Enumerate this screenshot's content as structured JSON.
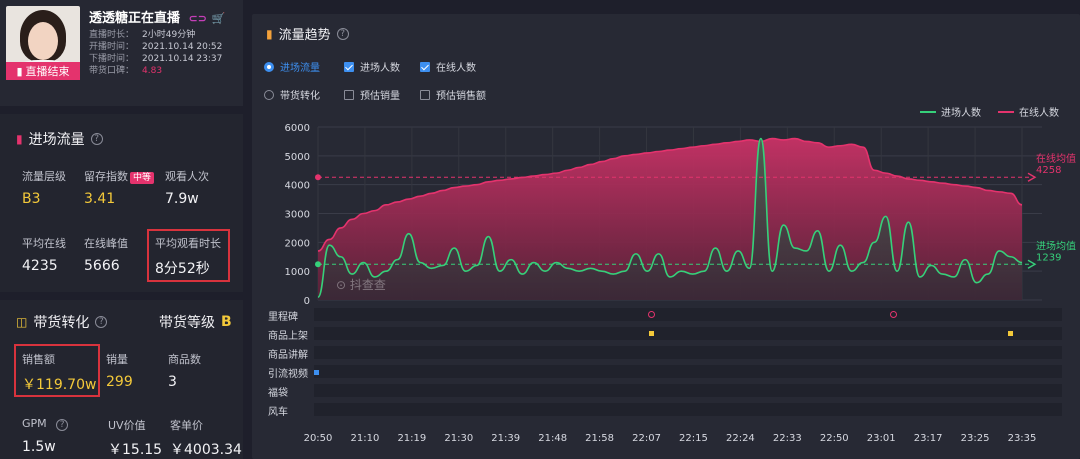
{
  "streamer": {
    "name": "透透糖正在直播",
    "live_status": "直播结束",
    "live_duration_label": "直播时长：",
    "live_duration": "2小时49分钟",
    "start_label": "开播时间：",
    "start_time": "2021.10.14 20:52",
    "end_label": "下播时间：",
    "end_time": "2021.10.14 23:37",
    "reputation_label": "带货口碑：",
    "reputation": "4.83"
  },
  "traffic": {
    "title": "进场流量",
    "flow_level_label": "流量层级",
    "flow_level": "B3",
    "retention_label": "留存指数",
    "retention_tag": "中等",
    "retention": "3.41",
    "views_label": "观看人次",
    "views": "7.9w",
    "avg_online_label": "平均在线",
    "avg_online": "4235",
    "peak_label": "在线峰值",
    "peak": "5666",
    "avg_watch_label": "平均观看时长",
    "avg_watch": "8分52秒"
  },
  "conversion": {
    "title": "带货转化",
    "grade_label": "带货等级",
    "grade": "B",
    "sales_label": "销售额",
    "sales": "￥119.70w",
    "volume_label": "销量",
    "volume": "299",
    "products_label": "商品数",
    "products": "3",
    "gpm_label": "GPM",
    "gpm": "1.5w",
    "uv_label": "UV价值",
    "uv": "￥15.15",
    "price_label": "客单价",
    "price": "￥4003.34"
  },
  "trend": {
    "title": "流量趋势",
    "radio_traffic": "进场流量",
    "radio_conversion": "带货转化",
    "cb_enter": "进场人数",
    "cb_online": "在线人数",
    "cb_est_volume": "预估销量",
    "cb_est_sales": "预估销售额",
    "online_avg_label": "在线均值",
    "online_avg": "4258",
    "enter_avg_label": "进场均值",
    "enter_avg": "1239",
    "watermark": "抖查查",
    "tracks": [
      "里程碑",
      "商品上架",
      "商品讲解",
      "引流视频",
      "福袋",
      "风车"
    ]
  },
  "colors": {
    "online": "#e4336d",
    "enter": "#36d07a",
    "accent_blue": "#3d8ff0",
    "highlight_red": "#d8333d",
    "yellow": "#f3c93a"
  },
  "chart_data": {
    "type": "area",
    "title": "",
    "ylim": [
      0,
      6000
    ],
    "y_ticks": [
      "0",
      "1000",
      "2000",
      "3000",
      "4000",
      "5000",
      "6000"
    ],
    "x_ticks": [
      "20:50",
      "21:10",
      "21:19",
      "21:30",
      "21:39",
      "21:48",
      "21:58",
      "22:07",
      "22:15",
      "22:24",
      "22:33",
      "22:50",
      "23:01",
      "23:17",
      "23:25",
      "23:35"
    ],
    "legend_position": "top-right",
    "series": [
      {
        "name": "进场人数",
        "values": [
          100,
          1900,
          1500,
          900,
          1300,
          800,
          1000,
          1400,
          2300,
          1300,
          1100,
          1200,
          1800,
          1000,
          1200,
          2200,
          1000,
          1400,
          900,
          1300,
          1000,
          1300,
          1100,
          1000,
          1100,
          1000,
          900,
          1000,
          1600,
          1000,
          1600,
          800,
          1000,
          900,
          1000,
          1800,
          1000,
          1700,
          1100,
          5600,
          1000,
          2600,
          1800,
          1700,
          2400,
          1000,
          1900,
          1000,
          1300,
          2000,
          2900,
          1000,
          2700,
          800,
          1200,
          900,
          800,
          1400,
          600,
          900,
          1700,
          1500,
          1300
        ]
      },
      {
        "name": "在线人数",
        "values": [
          1700,
          2100,
          2500,
          2800,
          3000,
          3100,
          3300,
          3400,
          3500,
          3600,
          3700,
          3800,
          3900,
          3950,
          4000,
          4100,
          4150,
          4200,
          4250,
          4300,
          4350,
          4400,
          4500,
          4600,
          4700,
          4800,
          4900,
          5000,
          5050,
          5100,
          5150,
          5200,
          5250,
          5300,
          5350,
          5400,
          5450,
          5500,
          5550,
          5500,
          5600,
          5550,
          5600,
          5500,
          5450,
          5300,
          5350,
          5400,
          5300,
          4500,
          4400,
          4300,
          4200,
          4150,
          4100,
          4050,
          4000,
          3950,
          3900,
          3800,
          3750,
          3700,
          3300
        ]
      }
    ],
    "reference_lines": [
      {
        "name": "在线均值",
        "value": 4258
      },
      {
        "name": "进场均值",
        "value": 1239
      }
    ]
  }
}
